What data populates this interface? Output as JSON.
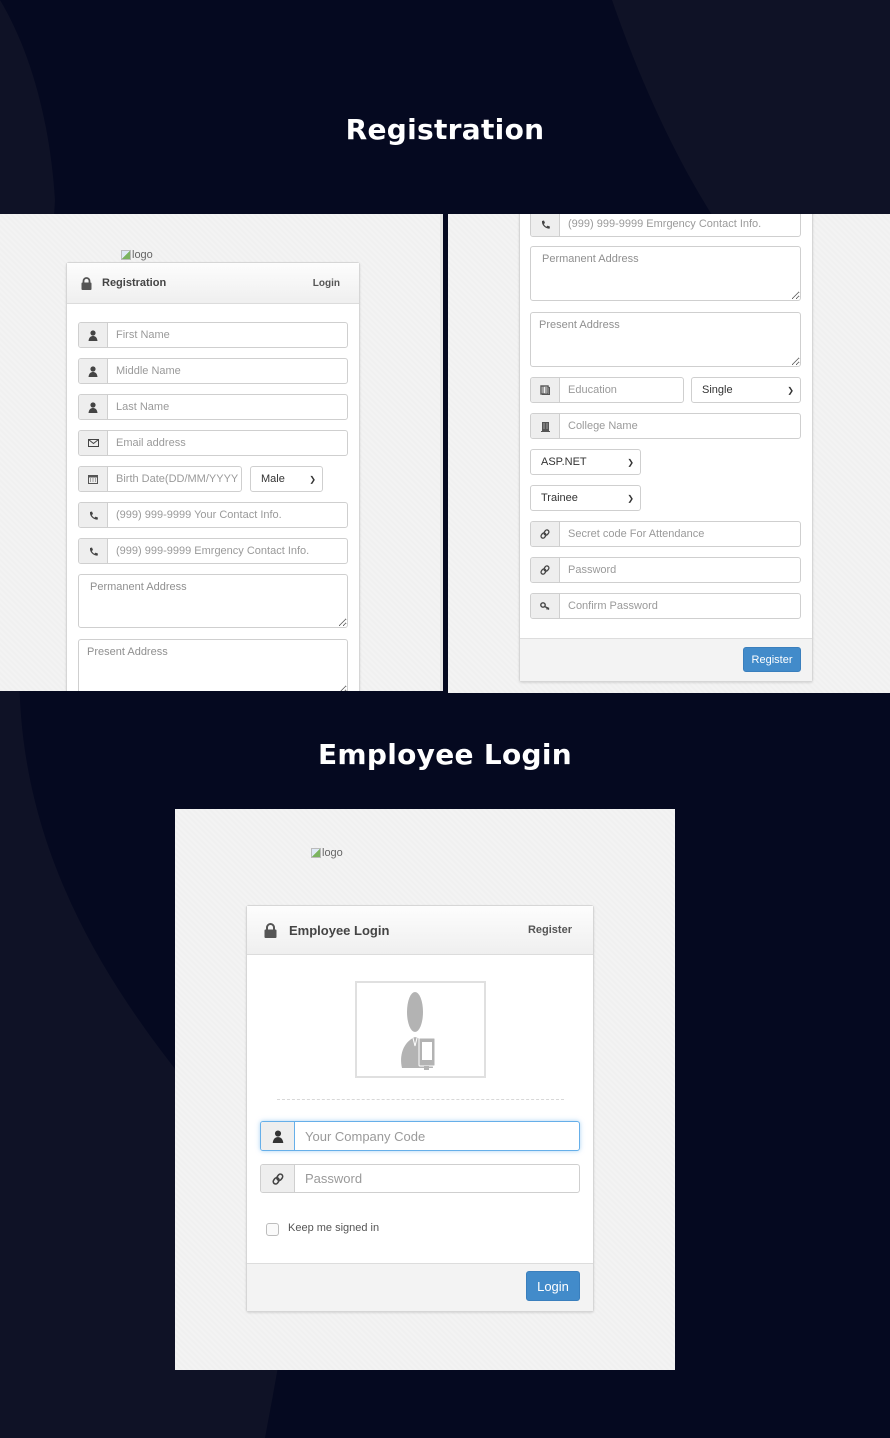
{
  "colors": {
    "page_background": "#050920",
    "background_shape": "#0f1226",
    "primary_button": "#428bca",
    "focus_border": "#66afe9"
  },
  "sections": {
    "registration_heading": "Registration",
    "login_heading": "Employee Login"
  },
  "registration_left": {
    "logo_alt": "logo",
    "panel_title": "Registration",
    "panel_link": "Login",
    "fields": {
      "first_name": {
        "placeholder": "First Name",
        "icon": "user-icon"
      },
      "middle_name": {
        "placeholder": "Middle Name",
        "icon": "user-icon"
      },
      "last_name": {
        "placeholder": "Last Name",
        "icon": "user-icon"
      },
      "email": {
        "placeholder": "Email address",
        "icon": "envelope-icon"
      },
      "birth_date": {
        "placeholder": "Birth Date(DD/MM/YYYY",
        "icon": "calendar-icon"
      },
      "gender": {
        "selected": "Male"
      },
      "contact": {
        "placeholder": "(999) 999-9999 Your Contact Info.",
        "icon": "phone-icon"
      },
      "emergency_contact": {
        "placeholder": "(999) 999-9999 Emrgency Contact Info.",
        "icon": "phone-icon"
      },
      "permanent_address": {
        "placeholder": "Permanent Address"
      },
      "present_address": {
        "placeholder": "Present Address"
      }
    }
  },
  "registration_right": {
    "fields": {
      "emergency_contact": {
        "placeholder": "(999) 999-9999 Emrgency Contact Info.",
        "icon": "phone-icon"
      },
      "permanent_address": {
        "placeholder": "Permanent Address"
      },
      "present_address": {
        "placeholder": "Present Address"
      },
      "education": {
        "placeholder": "Education",
        "icon": "book-icon"
      },
      "marital_status": {
        "selected": "Single"
      },
      "college_name": {
        "placeholder": "College Name",
        "icon": "building-icon"
      },
      "technology": {
        "selected": "ASP.NET"
      },
      "designation": {
        "selected": "Trainee"
      },
      "secret_code": {
        "placeholder": "Secret code For Attendance",
        "icon": "link-icon"
      },
      "password": {
        "placeholder": "Password",
        "icon": "link-icon"
      },
      "confirm_password": {
        "placeholder": "Confirm Password",
        "icon": "key-icon"
      }
    },
    "register_button": "Register"
  },
  "login": {
    "logo_alt": "logo",
    "panel_title": "Employee Login",
    "panel_link": "Register",
    "fields": {
      "company_code": {
        "placeholder": "Your Company Code",
        "icon": "user-icon"
      },
      "password": {
        "placeholder": "Password",
        "icon": "link-icon"
      }
    },
    "keep_signed_in": "Keep me signed in",
    "keep_signed_in_checked": false,
    "login_button": "Login"
  }
}
